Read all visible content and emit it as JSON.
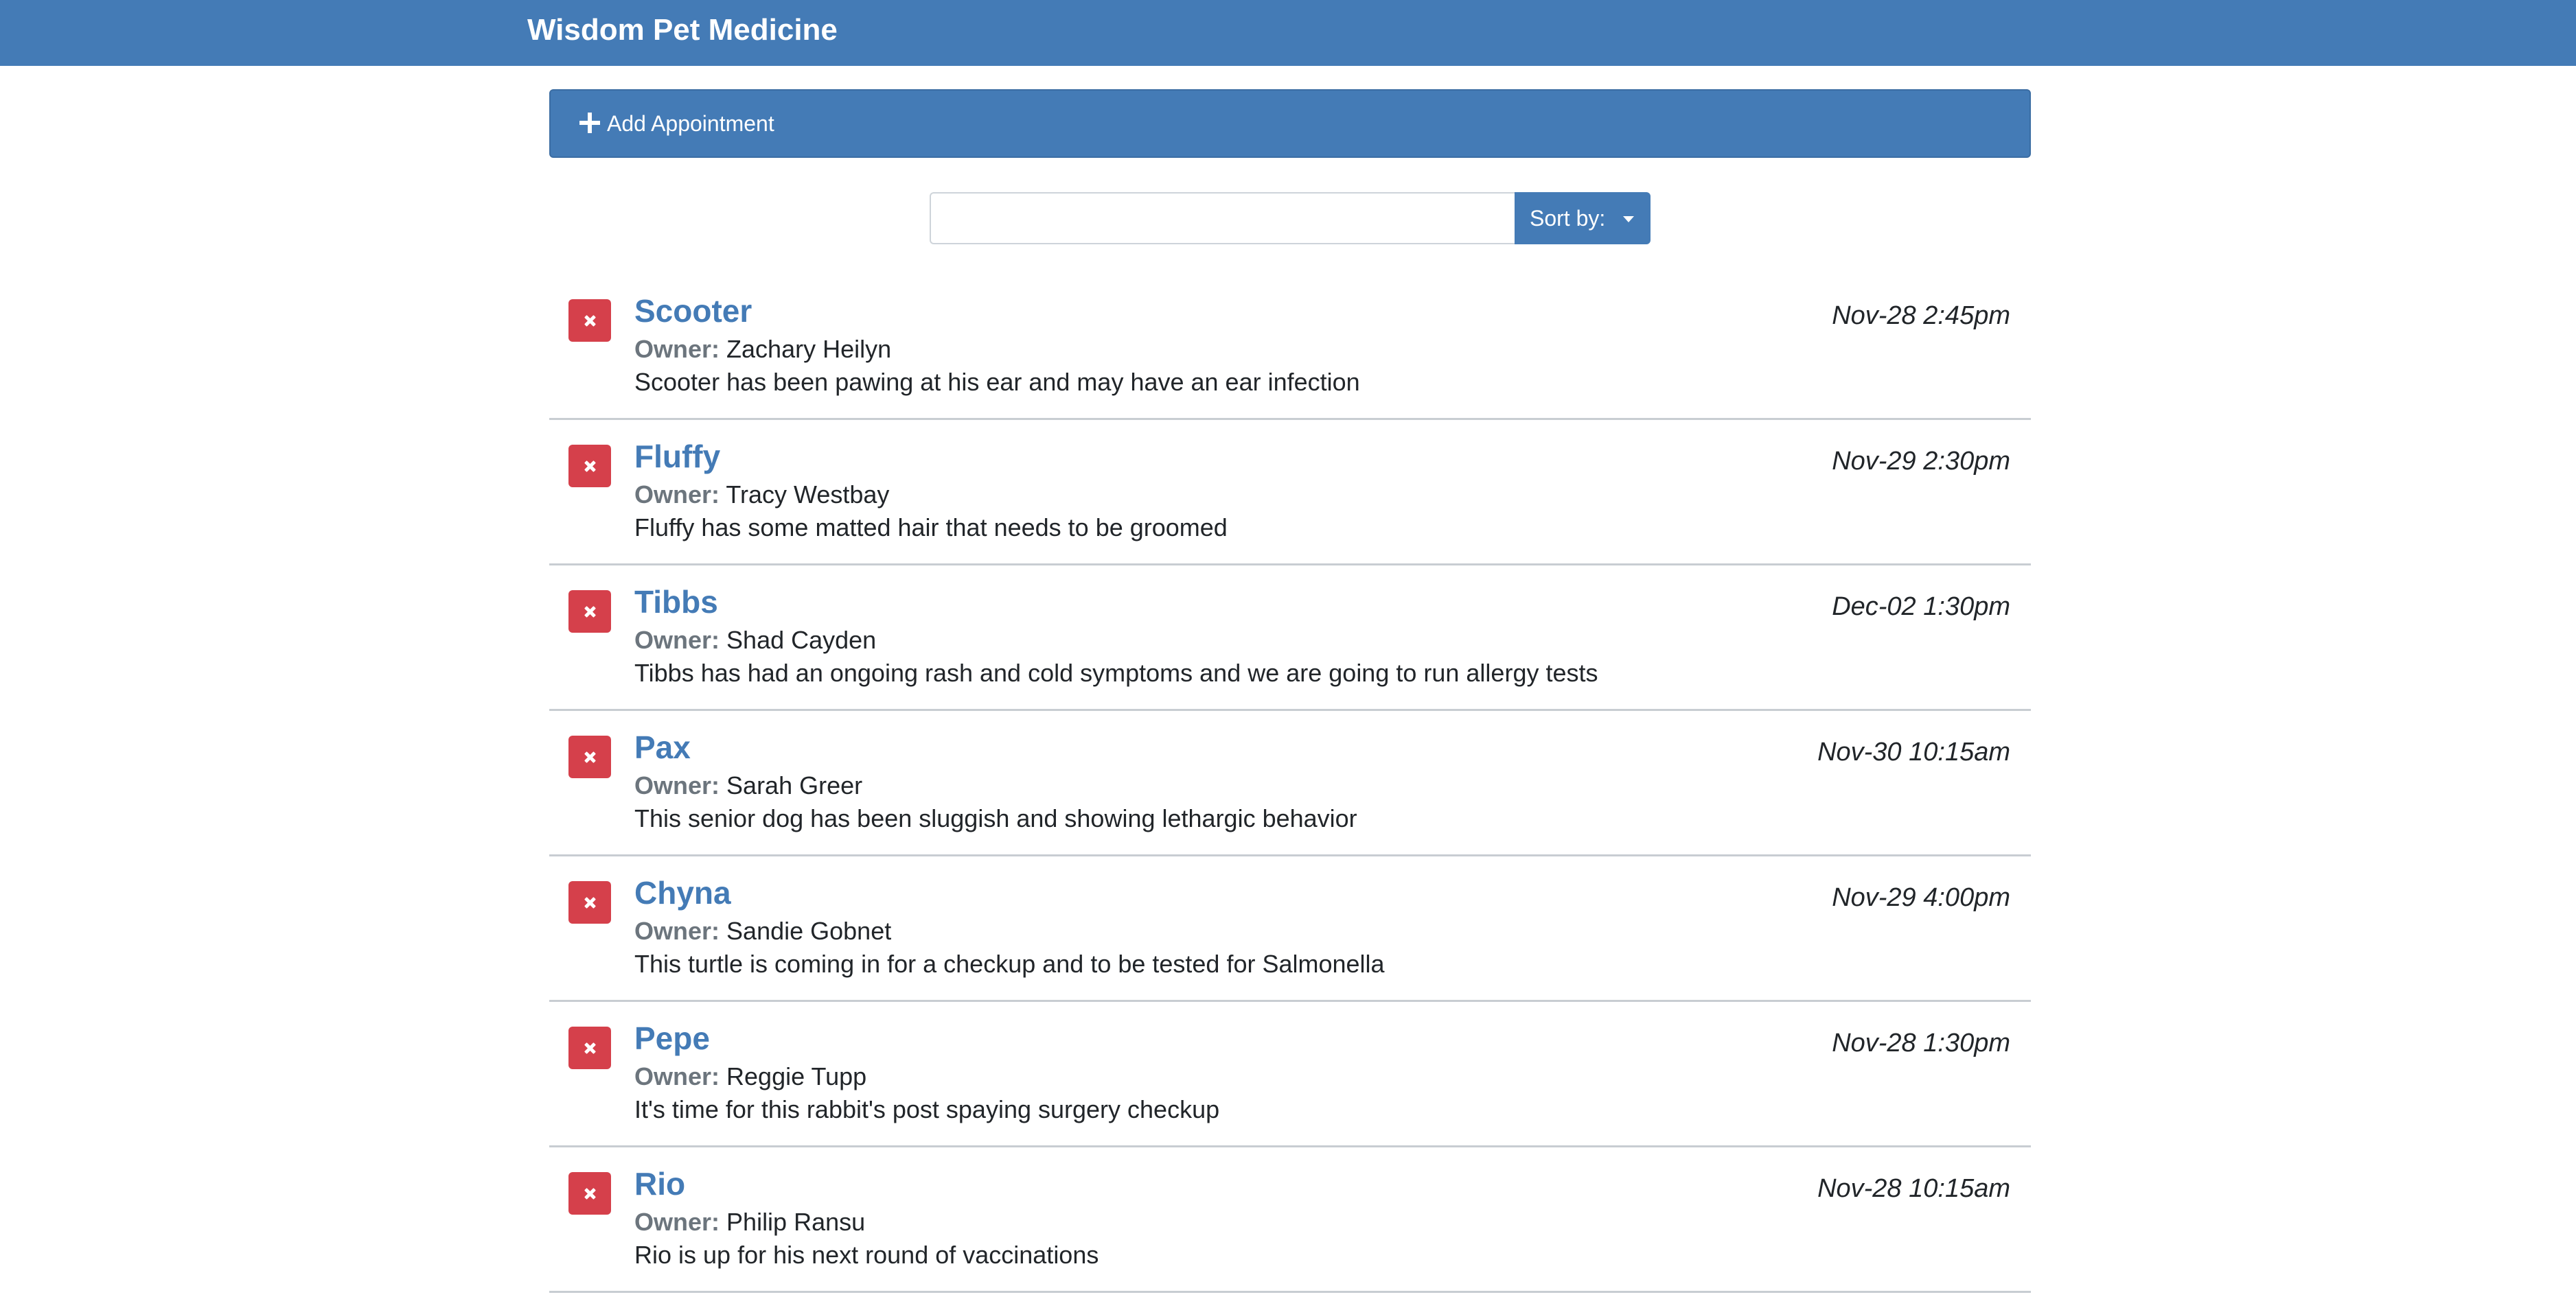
{
  "header": {
    "brand": "Wisdom Pet Medicine"
  },
  "add_appointment": {
    "label": "Add Appointment",
    "icon": "plus-icon"
  },
  "search": {
    "value": "",
    "placeholder": ""
  },
  "sort": {
    "label": "Sort by:",
    "icon": "caret-down-icon"
  },
  "owner_label": "Owner:",
  "appointments": [
    {
      "pet": "Scooter",
      "owner": "Zachary Heilyn",
      "notes": "Scooter has been pawing at his ear and may have an ear infection",
      "date": "Nov-28 2:45pm"
    },
    {
      "pet": "Fluffy",
      "owner": "Tracy Westbay",
      "notes": "Fluffy has some matted hair that needs to be groomed",
      "date": "Nov-29 2:30pm"
    },
    {
      "pet": "Tibbs",
      "owner": "Shad Cayden",
      "notes": "Tibbs has had an ongoing rash and cold symptoms and we are going to run allergy tests",
      "date": "Dec-02 1:30pm"
    },
    {
      "pet": "Pax",
      "owner": "Sarah Greer",
      "notes": "This senior dog has been sluggish and showing lethargic behavior",
      "date": "Nov-30 10:15am"
    },
    {
      "pet": "Chyna",
      "owner": "Sandie Gobnet",
      "notes": "This turtle is coming in for a checkup and to be tested for Salmonella",
      "date": "Nov-29 4:00pm"
    },
    {
      "pet": "Pepe",
      "owner": "Reggie Tupp",
      "notes": "It's time for this rabbit's post spaying surgery checkup",
      "date": "Nov-28 1:30pm"
    },
    {
      "pet": "Rio",
      "owner": "Philip Ransu",
      "notes": "Rio is up for his next round of vaccinations",
      "date": "Nov-28 10:15am"
    }
  ],
  "colors": {
    "primary": "#447bb6",
    "danger": "#d5404b",
    "muted": "#6c757d"
  }
}
